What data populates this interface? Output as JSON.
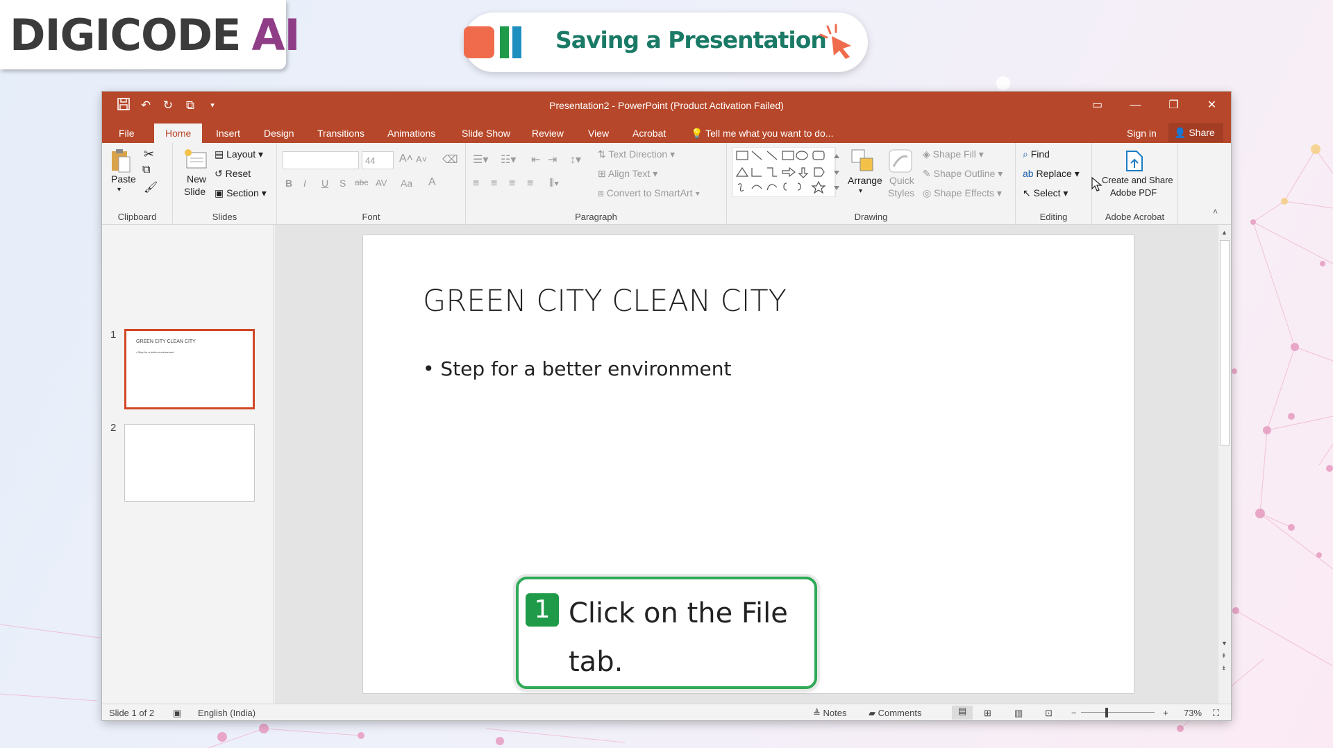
{
  "branding": {
    "logo_part1": "DIGICODE",
    "logo_part2": "AI",
    "logo_color_dark": "#3b3b3b",
    "logo_color_purple": "#8e3d86"
  },
  "banner": {
    "title": "Saving a Presentation",
    "title_color": "#1a7a66",
    "bar_colors": [
      "#ef6b4c",
      "#1e9a48",
      "#1c8fbf"
    ]
  },
  "window": {
    "title": "Presentation2 - PowerPoint (Product Activation Failed)",
    "accent": "#b7472a",
    "quick_access": [
      "save-icon",
      "undo-icon",
      "redo-icon",
      "start-from-beginning-icon",
      "customize-qat-icon"
    ]
  },
  "tabs": {
    "file": "File",
    "home": "Home",
    "insert": "Insert",
    "design": "Design",
    "transitions": "Transitions",
    "animations": "Animations",
    "slideshow": "Slide Show",
    "review": "Review",
    "view": "View",
    "acrobat": "Acrobat",
    "tellme": "Tell me what you want to do...",
    "signin": "Sign in",
    "share": "Share"
  },
  "ribbon": {
    "clipboard": {
      "label": "Clipboard",
      "paste": "Paste"
    },
    "slides": {
      "label": "Slides",
      "new_slide_1": "New",
      "new_slide_2": "Slide",
      "layout": "Layout",
      "reset": "Reset",
      "section": "Section"
    },
    "font": {
      "label": "Font",
      "size": "44",
      "bold": "B",
      "italic": "I",
      "underline": "U",
      "shadow": "S",
      "strike": "abc",
      "spacing": "AV",
      "case": "Aa",
      "color": "A"
    },
    "paragraph": {
      "label": "Paragraph",
      "text_direction": "Text Direction",
      "align_text": "Align Text",
      "smartart": "Convert to SmartArt"
    },
    "drawing": {
      "label": "Drawing",
      "arrange": "Arrange",
      "quick_styles_1": "Quick",
      "quick_styles_2": "Styles",
      "shape_fill": "Shape Fill",
      "shape_outline": "Shape Outline",
      "shape_effects": "Shape Effects"
    },
    "editing": {
      "label": "Editing",
      "find": "Find",
      "replace": "Replace",
      "select": "Select"
    },
    "acrobat": {
      "label": "Adobe Acrobat",
      "btn_1": "Create and Share",
      "btn_2": "Adobe PDF"
    }
  },
  "thumbnails": [
    {
      "num": "1",
      "title": "GREEN CITY CLEAN CITY",
      "bullet": "• Step for a better environment"
    },
    {
      "num": "2"
    }
  ],
  "slide": {
    "title": "GREEN CITY CLEAN CITY",
    "bullet": "• Step for a better environment"
  },
  "status": {
    "slide_count": "Slide 1 of 2",
    "language": "English (India)",
    "notes": "Notes",
    "comments": "Comments",
    "zoom": "73%"
  },
  "zoom_level": 0.73,
  "callout": {
    "number": "1",
    "text": "Click on the File tab.",
    "accent": "#2faa57"
  }
}
